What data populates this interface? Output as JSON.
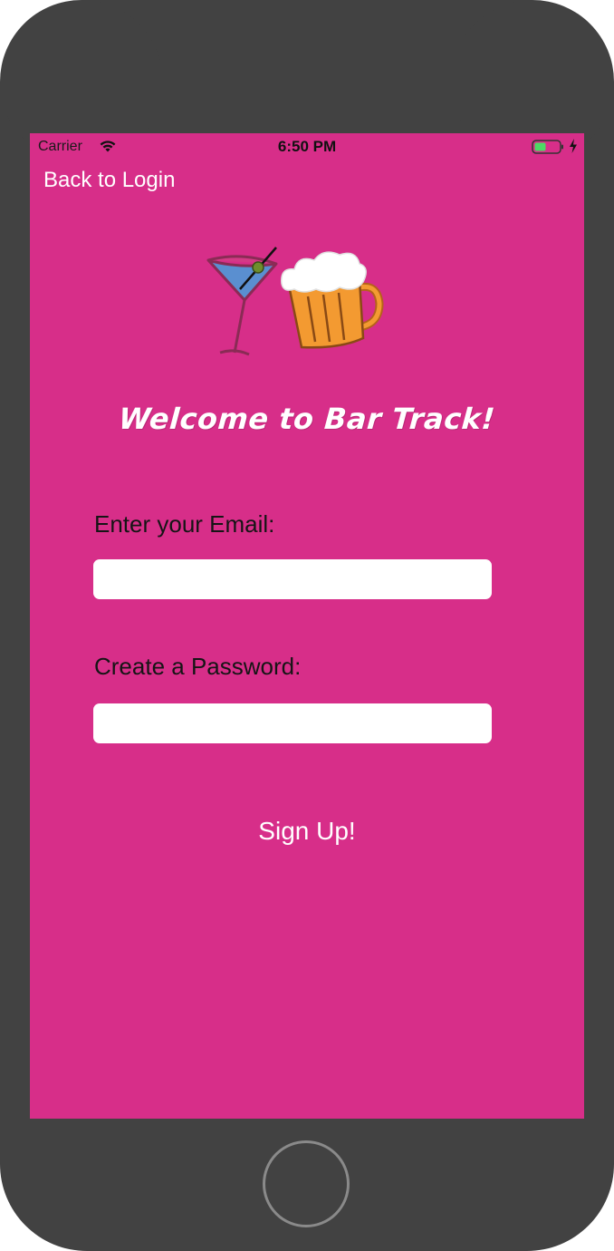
{
  "colors": {
    "screen_background": "#D72E89",
    "text_light": "#FFFFFF",
    "text_dark": "#151515",
    "device_body": "#424242"
  },
  "status_bar": {
    "carrier": "Carrier",
    "time": "6:50 PM",
    "wifi_icon": "wifi-icon",
    "battery_icon": "battery-icon",
    "charging_icon": "charging-bolt-icon"
  },
  "nav": {
    "back_label": "Back to Login"
  },
  "logo": {
    "icons": [
      "martini-glass-icon",
      "beer-mug-icon"
    ]
  },
  "welcome": {
    "title": "Welcome to Bar Track!"
  },
  "form": {
    "email_label": "Enter your Email:",
    "email_value": "",
    "email_placeholder": "",
    "password_label": "Create a Password:",
    "password_value": "",
    "password_placeholder": "",
    "submit_label": "Sign Up!"
  }
}
